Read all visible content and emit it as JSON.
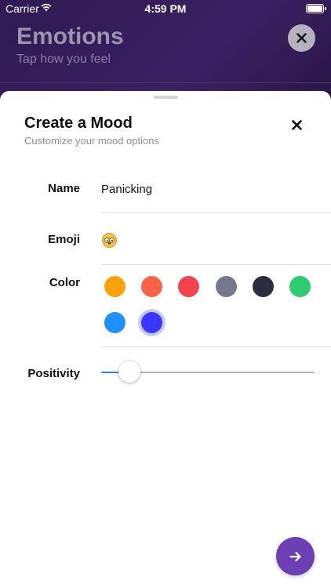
{
  "status_bar": {
    "carrier": "Carrier",
    "time": "4:59 PM"
  },
  "background_screen": {
    "title": "Emotions",
    "subtitle": "Tap how you feel",
    "close_icon": "close-icon"
  },
  "sheet": {
    "title": "Create a Mood",
    "subtitle": "Customize your mood options",
    "close_icon": "close-icon"
  },
  "form": {
    "name": {
      "label": "Name",
      "value": "Panicking"
    },
    "emoji": {
      "label": "Emoji",
      "value": "flushed-face-emoji"
    },
    "color": {
      "label": "Color",
      "options": [
        "#FFA10A",
        "#FF6347",
        "#F2434F",
        "#73798A",
        "#2A2D3B",
        "#2ECC71",
        "#1E90FF",
        "#3737FF"
      ],
      "selected": "#3737FF"
    },
    "positivity": {
      "label": "Positivity",
      "value": 0.13
    }
  },
  "fab": {
    "icon": "arrow-right-icon"
  },
  "colors": {
    "accent": "#6D3FB4",
    "slider_fill": "#2F82F0",
    "header_bg": "#2F1A52"
  }
}
